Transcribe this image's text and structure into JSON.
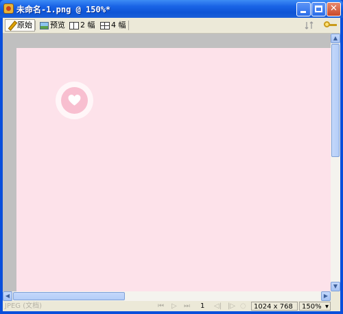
{
  "window": {
    "title": "未命名-1.png @ 150%*",
    "minimize_label": "",
    "maximize_label": "",
    "close_label": "✕"
  },
  "toolbar": {
    "original_label": "原始",
    "preview_label": "预览",
    "two_up_label": "2 幅",
    "four_up_label": "4 幅",
    "sort_icon": "sort-icon",
    "key_icon": "key-icon"
  },
  "canvas": {
    "background_color": "#fde2ea",
    "badge_icon": "heart-icon"
  },
  "scrollbars": {
    "up_arrow": "▲",
    "down_arrow": "▼",
    "left_arrow": "◀",
    "right_arrow": "▶"
  },
  "statusbar": {
    "format_text": "JPEG (文档)",
    "first_frame": "⏮",
    "play": "▷",
    "last_frame": "⏭",
    "frame_number": "1",
    "prev_frame": "◁|",
    "next_frame": "|▷",
    "loop": "◌",
    "dimensions": "1024 x 768",
    "zoom": "150%",
    "zoom_arrow": "▾"
  }
}
